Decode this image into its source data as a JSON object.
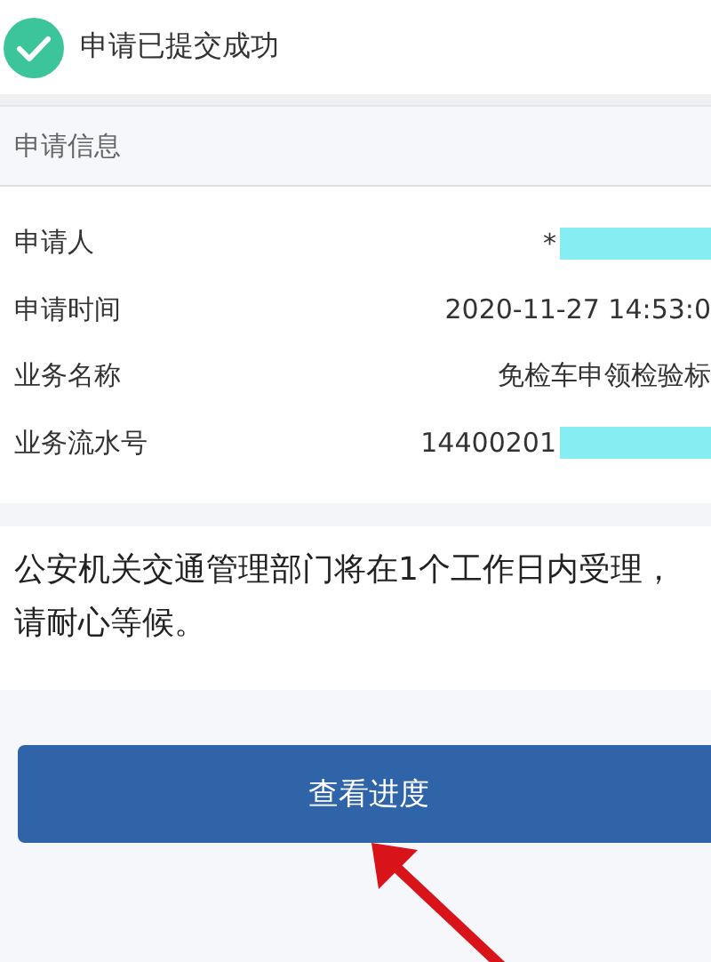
{
  "header": {
    "title": "申请已提交成功",
    "success": true
  },
  "section": {
    "title": "申请信息"
  },
  "rows": [
    {
      "label": "申请人",
      "value": "*",
      "redacted": true
    },
    {
      "label": "申请时间",
      "value": "2020-11-27 14:53:0",
      "redacted": false
    },
    {
      "label": "业务名称",
      "value": "免检车申领检验标",
      "redacted": false
    },
    {
      "label": "业务流水号",
      "value": "14400201",
      "redacted": true
    }
  ],
  "notice": "公安机关交通管理部门将在1个工作日内受理，请耐心等候。",
  "button": {
    "label": "查看进度"
  }
}
